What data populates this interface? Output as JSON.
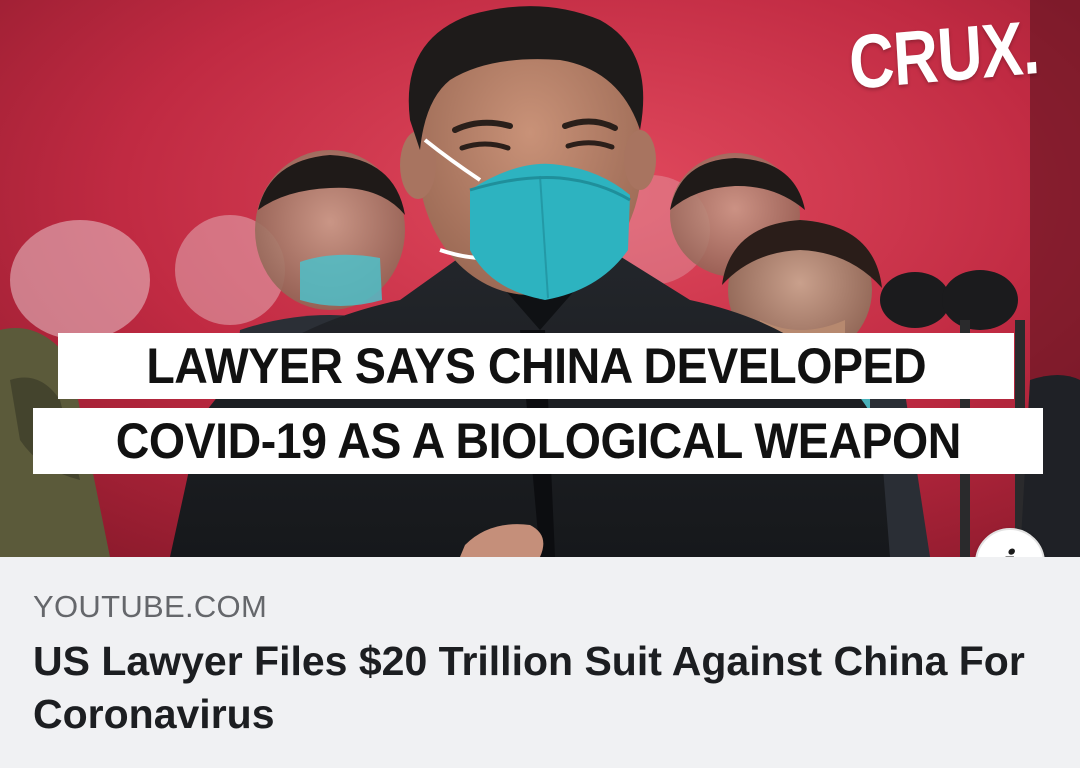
{
  "thumbnail": {
    "logo_text": "CRUX.",
    "headline_line1": "LAWYER SAYS CHINA DEVELOPED",
    "headline_line2": "COVID-19 AS A BIOLOGICAL WEAPON",
    "mask_color": "#2db3c0",
    "background_color": "#b2223a"
  },
  "info_button": {
    "icon": "info-icon",
    "glyph": "i"
  },
  "caption": {
    "source": "YOUTUBE.COM",
    "title": "US Lawyer Files $20 Trillion Suit Against China For Coronavirus"
  },
  "colors": {
    "caption_background": "#f0f1f3",
    "source_text": "#65676b",
    "title_text": "#1c1e21"
  }
}
